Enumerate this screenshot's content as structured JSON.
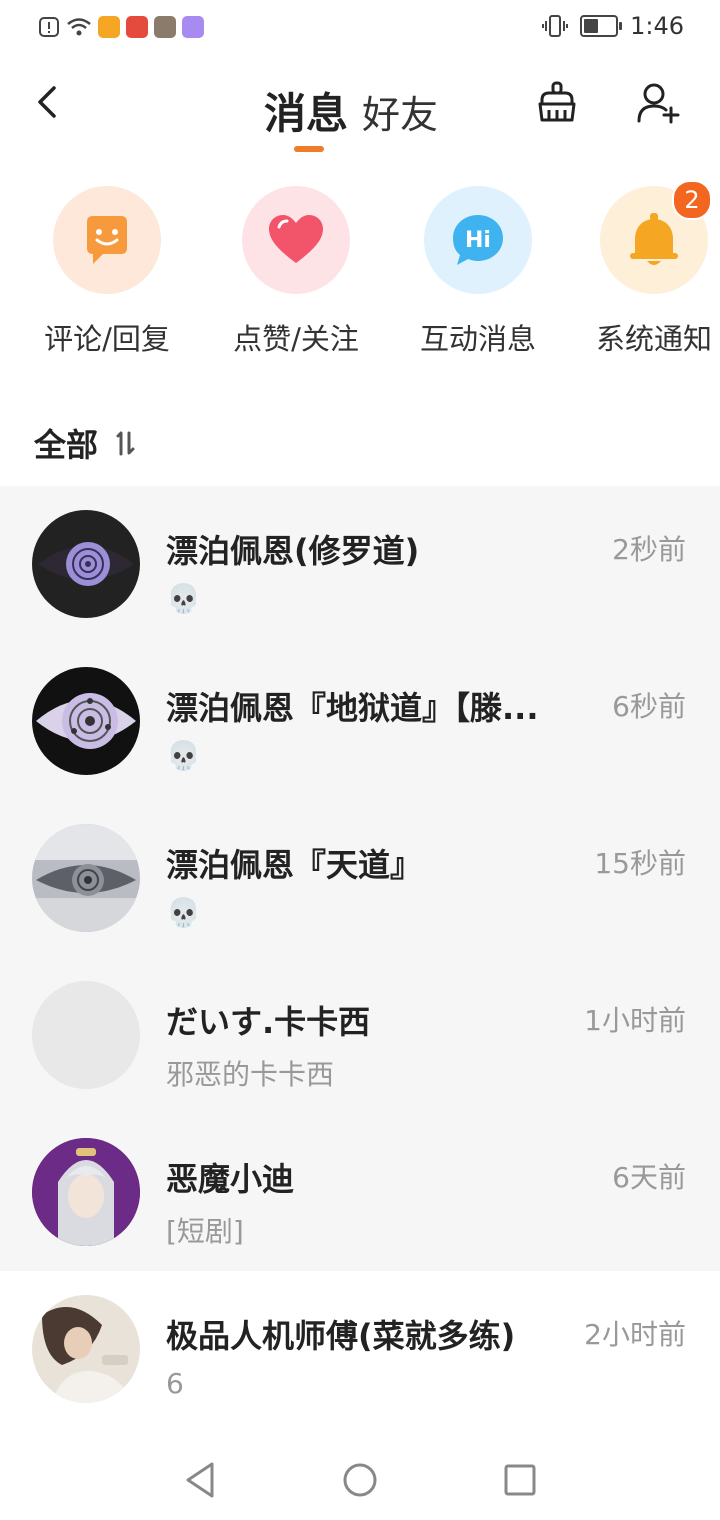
{
  "status_bar": {
    "time": "1:46"
  },
  "header": {
    "tab_active": "消息",
    "tab_inactive": "好友"
  },
  "quick_actions": [
    {
      "label": "评论/回复",
      "icon": "smile-chat-icon",
      "color": "#f79a3e",
      "bg": "#fde8da"
    },
    {
      "label": "点赞/关注",
      "icon": "heart-icon",
      "color": "#f2556a",
      "bg": "#fde3e6"
    },
    {
      "label": "互动消息",
      "icon": "hi-bubble-icon",
      "color": "#3fb2f0",
      "bg": "#dff1fc"
    },
    {
      "label": "系统通知",
      "icon": "bell-icon",
      "color": "#f5a623",
      "bg": "#fdefd8",
      "badge": "2"
    }
  ],
  "section": {
    "title": "全部"
  },
  "conversations": [
    {
      "name": "漂泊佩恩(修罗道)",
      "time": "2秒前",
      "preview": "💀"
    },
    {
      "name": "漂泊佩恩『地狱道』【滕...",
      "time": "6秒前",
      "preview": "💀"
    },
    {
      "name": "漂泊佩恩『天道』",
      "time": "15秒前",
      "preview": "💀"
    },
    {
      "name": "だいす.卡卡西",
      "time": "1小时前",
      "preview": "邪恶的卡卡西"
    },
    {
      "name": "恶魔小迪",
      "time": "6天前",
      "preview": "[短剧]"
    },
    {
      "name": "极品人机师傅(菜就多练)",
      "time": "2小时前",
      "preview": "6"
    }
  ],
  "colors": {
    "accent": "#f07c2a",
    "badge": "#f2661f"
  }
}
